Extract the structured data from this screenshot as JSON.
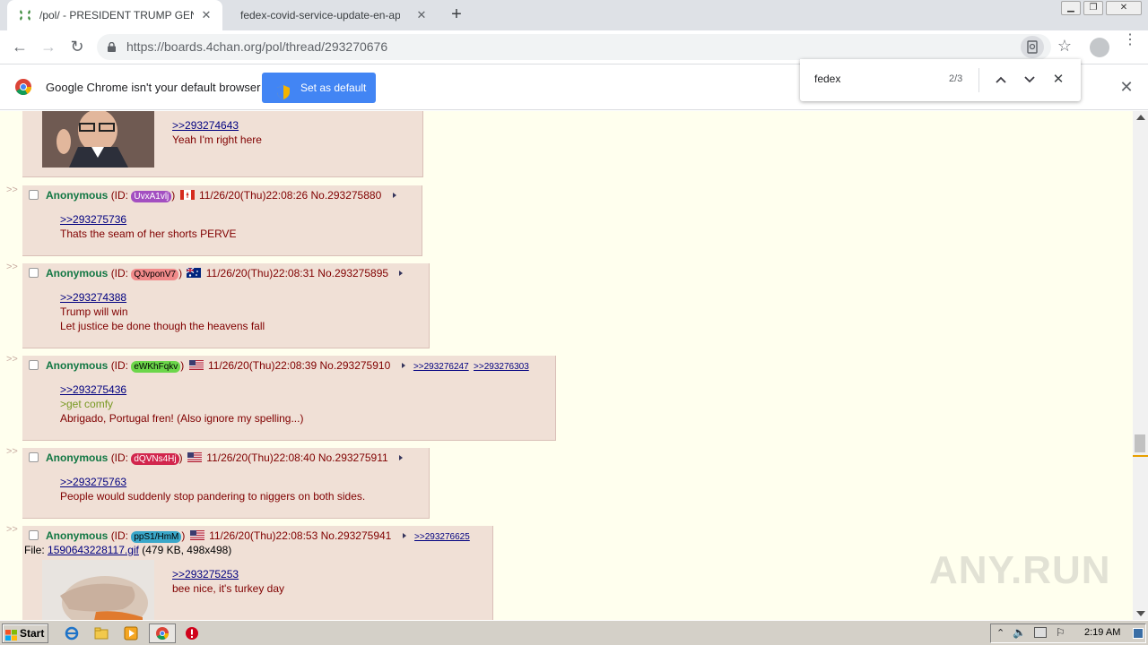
{
  "tabs": [
    {
      "title": "/pol/ - PRESIDENT TRUMP GENERAL",
      "active": true
    },
    {
      "title": "fedex-covid-service-update-en-apac",
      "active": false
    }
  ],
  "toolbar": {
    "url_host": "https://boards.4chan.org",
    "url_path": "/pol/thread/293270676"
  },
  "infobar": {
    "message": "Google Chrome isn't your default browser",
    "button_label": "Set as default"
  },
  "findbar": {
    "query": "fedex",
    "count": "2/3"
  },
  "thread": {
    "colors": {
      "background": "#ffffee",
      "post": "#f0e0d6",
      "name": "#117743",
      "text": "#800000",
      "link": "#000080",
      "greentext": "#789922"
    },
    "posts": [
      {
        "partial": true,
        "quotes": [
          ">>293274643"
        ],
        "lines": [
          "Yeah I'm right here"
        ]
      },
      {
        "name": "Anonymous",
        "id_prefix": "(ID: ",
        "id": "UvxA1vlj",
        "id_color": "#a34fc1",
        "flag": "canada",
        "date": "11/26/20(Thu)22:08:26",
        "no": "No.293275880",
        "backlinks": [],
        "quotes": [
          ">>293275736"
        ],
        "lines": [
          "Thats the seam of her shorts PERVE"
        ]
      },
      {
        "name": "Anonymous",
        "id_prefix": "(ID: ",
        "id": "QJvponV7",
        "id_color": "#f08a8a",
        "flag": "australia",
        "date": "11/26/20(Thu)22:08:31",
        "no": "No.293275895",
        "backlinks": [],
        "quotes": [
          ">>293274388"
        ],
        "lines": [
          "Trump will win",
          "Let justice be done though the heavens fall"
        ]
      },
      {
        "name": "Anonymous",
        "id_prefix": "(ID: ",
        "id": "eWKhFqkv",
        "id_color": "#6cd64a",
        "flag": "usa",
        "date": "11/26/20(Thu)22:08:39",
        "no": "No.293275910",
        "backlinks": [
          ">>293276247",
          ">>293276303"
        ],
        "quotes": [
          ">>293275436"
        ],
        "greentext": ">get comfy",
        "lines": [
          "Abrigado, Portugal fren! (Also ignore my spelling...)"
        ]
      },
      {
        "name": "Anonymous",
        "id_prefix": "(ID: ",
        "id": "dQVNs4Hj",
        "id_color": "#d2264d",
        "flag": "usa",
        "date": "11/26/20(Thu)22:08:40",
        "no": "No.293275911",
        "backlinks": [],
        "quotes": [
          ">>293275763"
        ],
        "lines": [
          "People would suddenly stop pandering to niggers on both sides."
        ]
      },
      {
        "name": "Anonymous",
        "id_prefix": "(ID: ",
        "id": "ppS1/HmM",
        "id_color": "#3aa7c9",
        "flag": "usa",
        "date": "11/26/20(Thu)22:08:53",
        "no": "No.293275941",
        "backlinks": [
          ">>293276625"
        ],
        "file_label": "File: ",
        "file_name": "1590643228117.gif",
        "file_meta": " (479 KB, 498x498)",
        "quotes": [
          ">>293275253"
        ],
        "lines": [
          "bee nice, it's turkey day"
        ]
      }
    ],
    "id_close": ")"
  },
  "watermark": "ANY.RUN",
  "taskbar": {
    "start_label": "Start",
    "clock": "2:19 AM",
    "icons": [
      "ie-icon",
      "folder-icon",
      "media-player-icon",
      "chrome-icon",
      "stop-icon"
    ]
  }
}
